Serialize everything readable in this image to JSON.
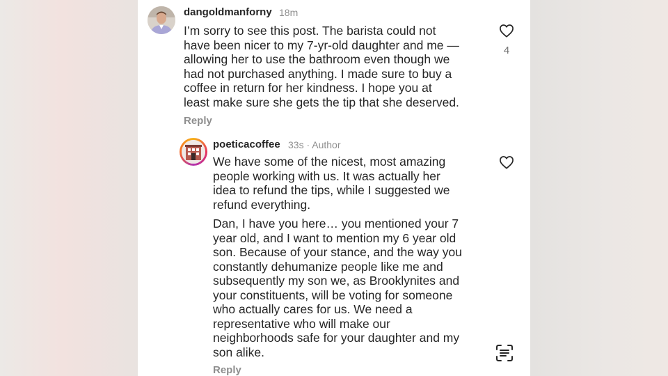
{
  "comment": {
    "username": "dangoldmanforny",
    "time": "18m",
    "text": "I’m sorry to see this post. The barista could not\nhave been nicer to my 7-yr-old daughter and me —\nallowing her to use the bathroom even though we\nhad not purchased anything. I made sure to buy a\ncoffee in return for her kindness. I hope you at\nleast make sure she gets the tip that she deserved.",
    "reply_label": "Reply",
    "like_count": "4",
    "like_icon": "heart-outline-icon"
  },
  "reply": {
    "username": "poeticacoffee",
    "meta": "33s · Author",
    "paragraph1": "We have some of the nicest, most amazing\npeople working with us. It was actually her\nidea to refund the tips, while I suggested we\nrefund everything.",
    "paragraph2": "Dan,  I have you here… you mentioned your 7\nyear old, and I want to mention my 6 year old\nson. Because of your stance, and the way you\nconstantly dehumanize people like me and\nsubsequently my son we, as Brooklynites and\nyour constituents, will be voting for someone\nwho actually cares for us. We need a\nrepresentative who will make our\nneighborhoods safe for your daughter and my\nson alike.",
    "reply_label": "Reply",
    "like_icon": "heart-outline-icon"
  },
  "overlay": {
    "scan_icon": "text-scan-icon"
  },
  "colors": {
    "text_primary": "#262626",
    "text_secondary": "#8e8e8e",
    "story_ring": [
      "#f7b21a",
      "#e8325c",
      "#b032b0"
    ]
  }
}
